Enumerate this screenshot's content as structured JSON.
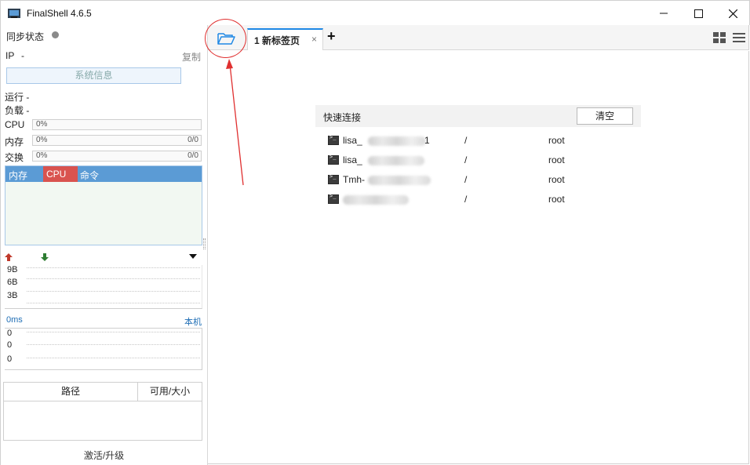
{
  "window": {
    "title": "FinalShell 4.6.5",
    "controls": [
      "minimize",
      "maximize",
      "close"
    ]
  },
  "sidebar": {
    "sync_label": "同步状态",
    "ip_label": "IP",
    "ip_value": "-",
    "copy_label": "复制",
    "sysinfo_button": "系统信息",
    "run_label": "运行 -",
    "load_label": "负载 -",
    "cpu": {
      "label": "CPU",
      "value": "0%"
    },
    "mem": {
      "label": "内存",
      "value": "0%",
      "extra": "0/0"
    },
    "swap": {
      "label": "交换",
      "value": "0%",
      "extra": "0/0"
    },
    "proc_headers": [
      "内存",
      "CPU",
      "命令"
    ],
    "net_ticks": [
      "9B",
      "6B",
      "3B"
    ],
    "ping_ms": "0ms",
    "ping_host": "本机",
    "ping_ticks": [
      "0",
      "0",
      "0"
    ],
    "disk_headers": [
      "路径",
      "可用/大小"
    ],
    "activate": "激活/升级"
  },
  "tabs": {
    "items": [
      {
        "label": "1 新标签页",
        "close": "×"
      }
    ],
    "add_label": "+"
  },
  "quick_connect": {
    "title": "快速连接",
    "clear_button": "清空",
    "rows": [
      {
        "name": "lisa_",
        "name_tail": "1",
        "path": "/",
        "user": "root"
      },
      {
        "name": "lisa_",
        "name_tail": "",
        "path": "/",
        "user": "root"
      },
      {
        "name": "Tmh-",
        "name_tail": "",
        "path": "/",
        "user": "root"
      },
      {
        "name": "",
        "name_tail": "",
        "path": "/",
        "user": "root"
      }
    ]
  },
  "colors": {
    "accent": "#1e88e5",
    "proc_header": "#5b9bd5",
    "cpu_header": "#d9534f",
    "annotation": "#e03030"
  }
}
